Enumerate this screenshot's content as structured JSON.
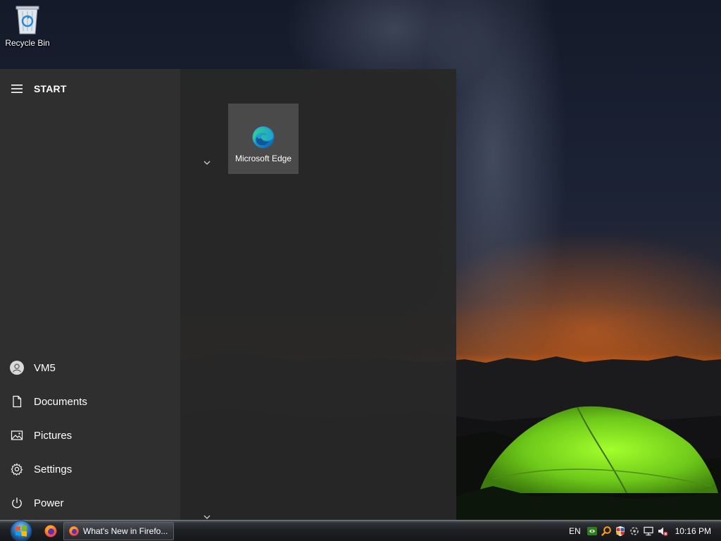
{
  "desktop": {
    "icons": [
      {
        "label": "Recycle Bin",
        "icon": "recycle-bin-icon"
      }
    ]
  },
  "start_menu": {
    "title": "START",
    "menu_icon": "hamburger-menu-icon",
    "left_items": [
      {
        "label": "VM5",
        "icon": "user-avatar-icon"
      },
      {
        "label": "Documents",
        "icon": "document-icon"
      },
      {
        "label": "Pictures",
        "icon": "pictures-icon"
      },
      {
        "label": "Settings",
        "icon": "gear-icon"
      },
      {
        "label": "Power",
        "icon": "power-icon"
      }
    ],
    "tiles": [
      {
        "label": "Microsoft Edge",
        "icon": "edge-icon"
      }
    ]
  },
  "taskbar": {
    "start_icon": "windows-orb-icon",
    "quick_launch": [
      {
        "name": "Firefox",
        "icon": "firefox-icon"
      }
    ],
    "tasks": [
      {
        "label": "What's New in Firefo...",
        "icon": "firefox-icon"
      }
    ],
    "tray": {
      "language": "EN",
      "icons": [
        "nvidia-icon",
        "search-icon",
        "security-shield-icon",
        "sync-icon",
        "network-icon",
        "volume-muted-icon"
      ],
      "clock": "10:16 PM"
    }
  },
  "colors": {
    "start_menu_bg": "#282828",
    "start_left_bg": "#2f2f2f",
    "tile_bg": "#4a4a4a",
    "taskbar_bg": "#1d1f23"
  }
}
